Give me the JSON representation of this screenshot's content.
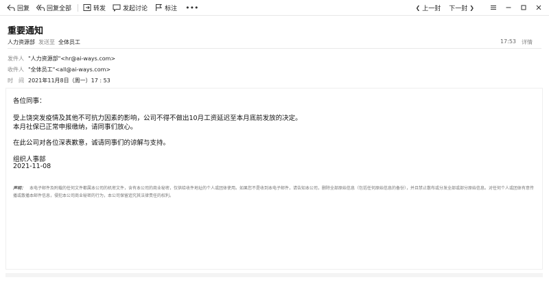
{
  "toolbar": {
    "reply": "回复",
    "reply_all": "回复全部",
    "forward": "转发",
    "discuss": "发起讨论",
    "mark": "标注",
    "more": "•••",
    "prev": "上一封",
    "next": "下一封"
  },
  "mail": {
    "subject": "重要通知",
    "sender_name": "人力资源部",
    "sent_to_label": "发送至",
    "recipient_name": "全体员工",
    "time_short": "17:53",
    "detail_label": "详情",
    "from_label": "发件人",
    "from_value": "\"人力资源部\"<hr@ai-ways.com>",
    "to_label": "收件人",
    "to_value": "\"全体员工\"<all@ai-ways.com>",
    "date_label": "时　间",
    "date_value": "2021年11月8日（周一）17 : 53"
  },
  "content": {
    "greeting": "各位同事：",
    "line1": "受上饶突发疫情及其他不可抗力因素的影响，公司不得不做出10月工资延迟至本月底前发放的决定。",
    "line2": "本月社保已正常申报缴纳，请同事们放心。",
    "line3": "在此公司对各位深表歉意，诚请同事们的谅解与支持。",
    "signature": "组织人事部",
    "sign_date": "2021-11-08",
    "disclaimer_label": "声明：",
    "disclaimer_text": "本电子邮件及附载的任何文件都属本公司的机密文件，含有本公司的商业秘密，仅供给收件地址的个人或团体使用。如果您不是收到本电子邮件，请告知本公司，删除全部原始信息（包括任何原始信息的备份），并且禁止散布或分发全部或部分原始信息。对任何个人或团体有意传播或散播本邮件信息，侵犯本公司商业秘密的行为，本公司保留追究其法律责任的权利。"
  }
}
